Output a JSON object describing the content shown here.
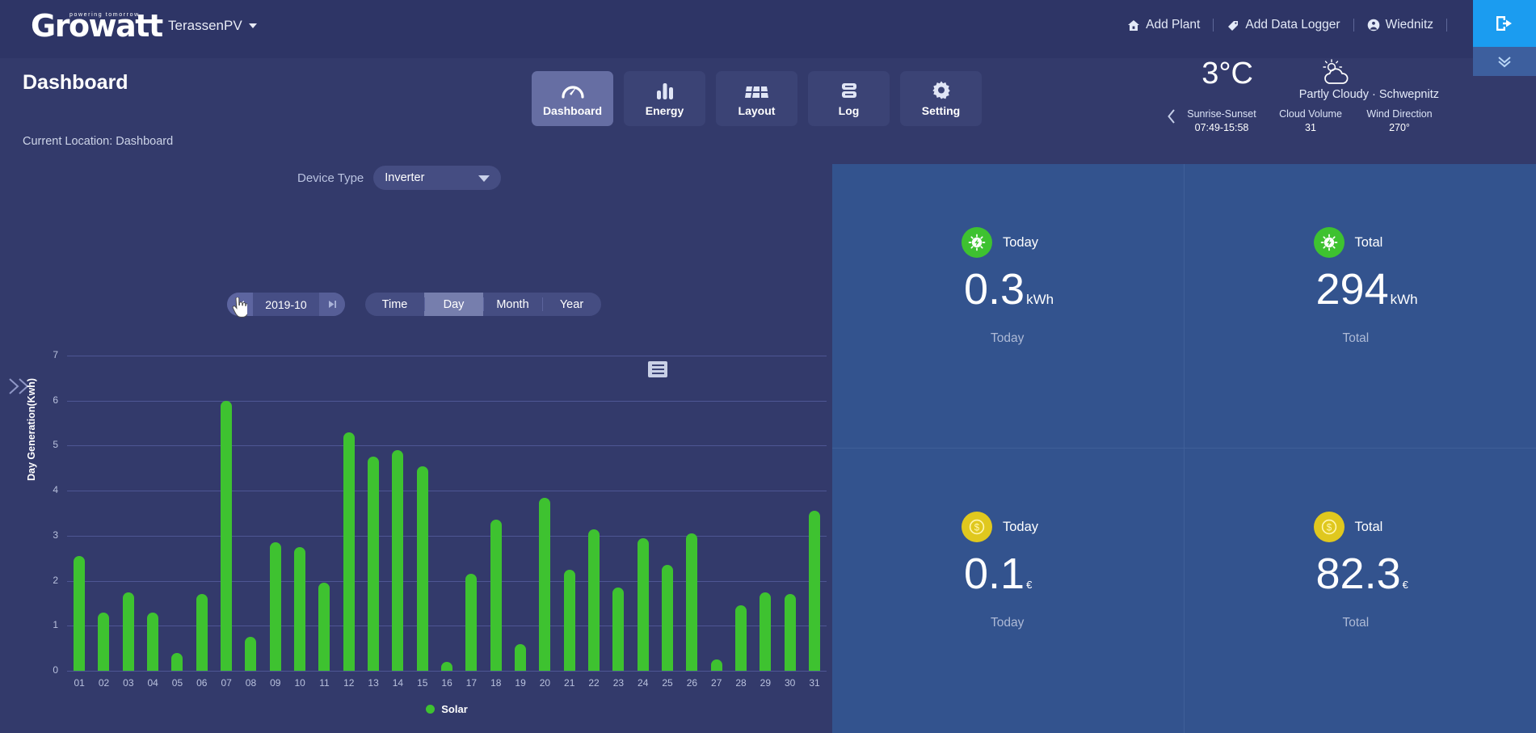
{
  "header": {
    "logo_text": "rowatt",
    "logo_initial": "G",
    "logo_tagline": "powering tomorrow",
    "plant_name": "TerassenPV",
    "links": [
      {
        "label": "Add Plant",
        "icon": "home-icon"
      },
      {
        "label": "Add Data Logger",
        "icon": "tag-icon"
      },
      {
        "label": "Wiednitz",
        "icon": "user-icon"
      }
    ],
    "logout_icon": "logout-icon",
    "collapse_icon": "chevron-double-down-icon"
  },
  "page": {
    "title": "Dashboard",
    "breadcrumb": "Current Location: Dashboard"
  },
  "nav": {
    "tabs": [
      {
        "label": "Dashboard",
        "icon": "gauge-icon",
        "active": true
      },
      {
        "label": "Energy",
        "icon": "bar-chart-icon",
        "active": false
      },
      {
        "label": "Layout",
        "icon": "solar-panel-icon",
        "active": false
      },
      {
        "label": "Log",
        "icon": "log-list-icon",
        "active": false
      },
      {
        "label": "Setting",
        "icon": "gear-icon",
        "active": false
      }
    ]
  },
  "weather": {
    "temperature": "3°C",
    "condition": "Partly Cloudy · Schwepnitz",
    "icon": "partly-cloudy-icon",
    "prev_icon": "chevron-left-icon",
    "stats": [
      {
        "key": "Sunrise-Sunset",
        "value": "07:49-15:58"
      },
      {
        "key": "Cloud Volume",
        "value": "31"
      },
      {
        "key": "Wind Direction",
        "value": "270°"
      }
    ]
  },
  "controls": {
    "device_type_label": "Device Type",
    "device_type_value": "Inverter",
    "date_value": "2019-10",
    "prev_icon": "prev-step-icon",
    "next_icon": "next-step-icon",
    "periods": [
      {
        "label": "Time",
        "active": false
      },
      {
        "label": "Day",
        "active": true
      },
      {
        "label": "Month",
        "active": false
      },
      {
        "label": "Year",
        "active": false
      }
    ]
  },
  "chart_data": {
    "type": "bar",
    "title": "",
    "xlabel": "",
    "ylabel": "Day Generation(Kwh)",
    "ylim": [
      0,
      7
    ],
    "yticks": [
      0,
      1,
      2,
      3,
      4,
      5,
      6,
      7
    ],
    "grid": true,
    "legend_position": "bottom",
    "series": [
      {
        "name": "Solar",
        "color": "#3ec230",
        "values": [
          2.55,
          1.3,
          1.75,
          1.3,
          0.4,
          1.7,
          6.0,
          0.75,
          2.85,
          2.75,
          1.95,
          5.3,
          4.75,
          4.9,
          4.55,
          0.2,
          2.15,
          3.35,
          0.6,
          3.85,
          2.25,
          3.15,
          1.85,
          2.95,
          2.35,
          3.05,
          0.25,
          1.45,
          1.75,
          1.7,
          3.55
        ]
      }
    ],
    "categories": [
      "01",
      "02",
      "03",
      "04",
      "05",
      "06",
      "07",
      "08",
      "09",
      "10",
      "11",
      "12",
      "13",
      "14",
      "15",
      "16",
      "17",
      "18",
      "19",
      "20",
      "21",
      "22",
      "23",
      "24",
      "25",
      "26",
      "27",
      "28",
      "29",
      "30",
      "31"
    ],
    "legend": [
      "Solar"
    ],
    "menu_icon": "hamburger-menu-icon"
  },
  "stats": [
    {
      "icon": "solar-energy-icon",
      "badge_color": "#3ec230",
      "title": "Today",
      "value": "0.3",
      "unit": "kWh",
      "unit_small": false,
      "footer": "Today"
    },
    {
      "icon": "solar-energy-icon",
      "badge_color": "#3ec230",
      "title": "Total",
      "value": "294",
      "unit": "kWh",
      "unit_small": false,
      "footer": "Total"
    },
    {
      "icon": "money-icon",
      "badge_color": "#e0c81e",
      "title": "Today",
      "value": "0.1",
      "unit": "€",
      "unit_small": true,
      "footer": "Today"
    },
    {
      "icon": "money-icon",
      "badge_color": "#e0c81e",
      "title": "Total",
      "value": "82.3",
      "unit": "€",
      "unit_small": true,
      "footer": "Total"
    }
  ],
  "sidebar": {
    "expand_icon": "chevron-double-right-icon"
  }
}
